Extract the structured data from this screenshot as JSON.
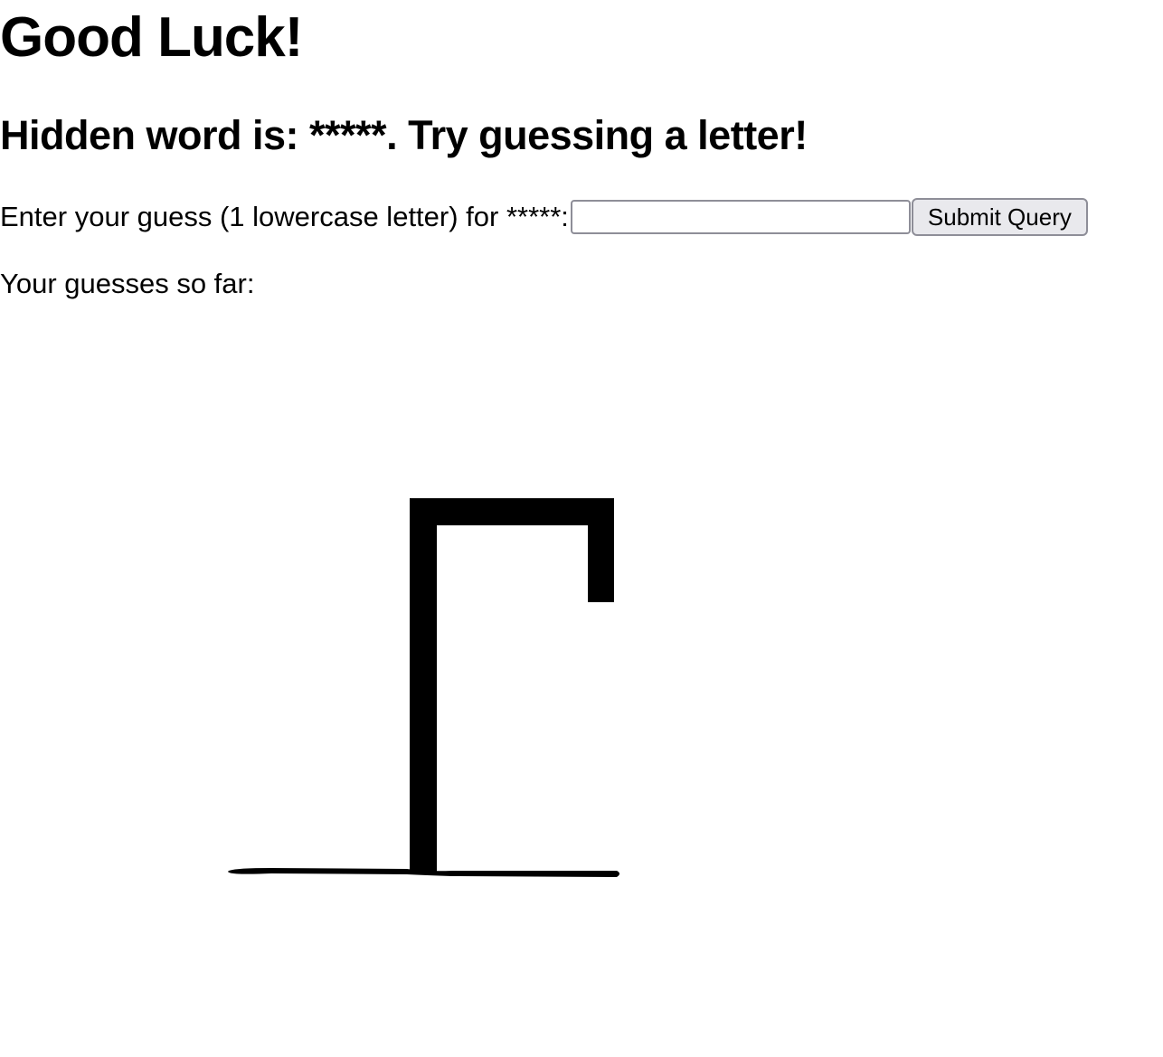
{
  "header": {
    "title": "Good Luck!",
    "status": "Hidden word is: *****. Try guessing a letter!"
  },
  "guess_form": {
    "label": "Enter your guess (1 lowercase letter) for *****:",
    "input_value": "",
    "submit_label": "Submit Query"
  },
  "guesses": {
    "label": "Your guesses so far:"
  },
  "hangman": {
    "stage": 0,
    "stroke_color": "#000000"
  }
}
